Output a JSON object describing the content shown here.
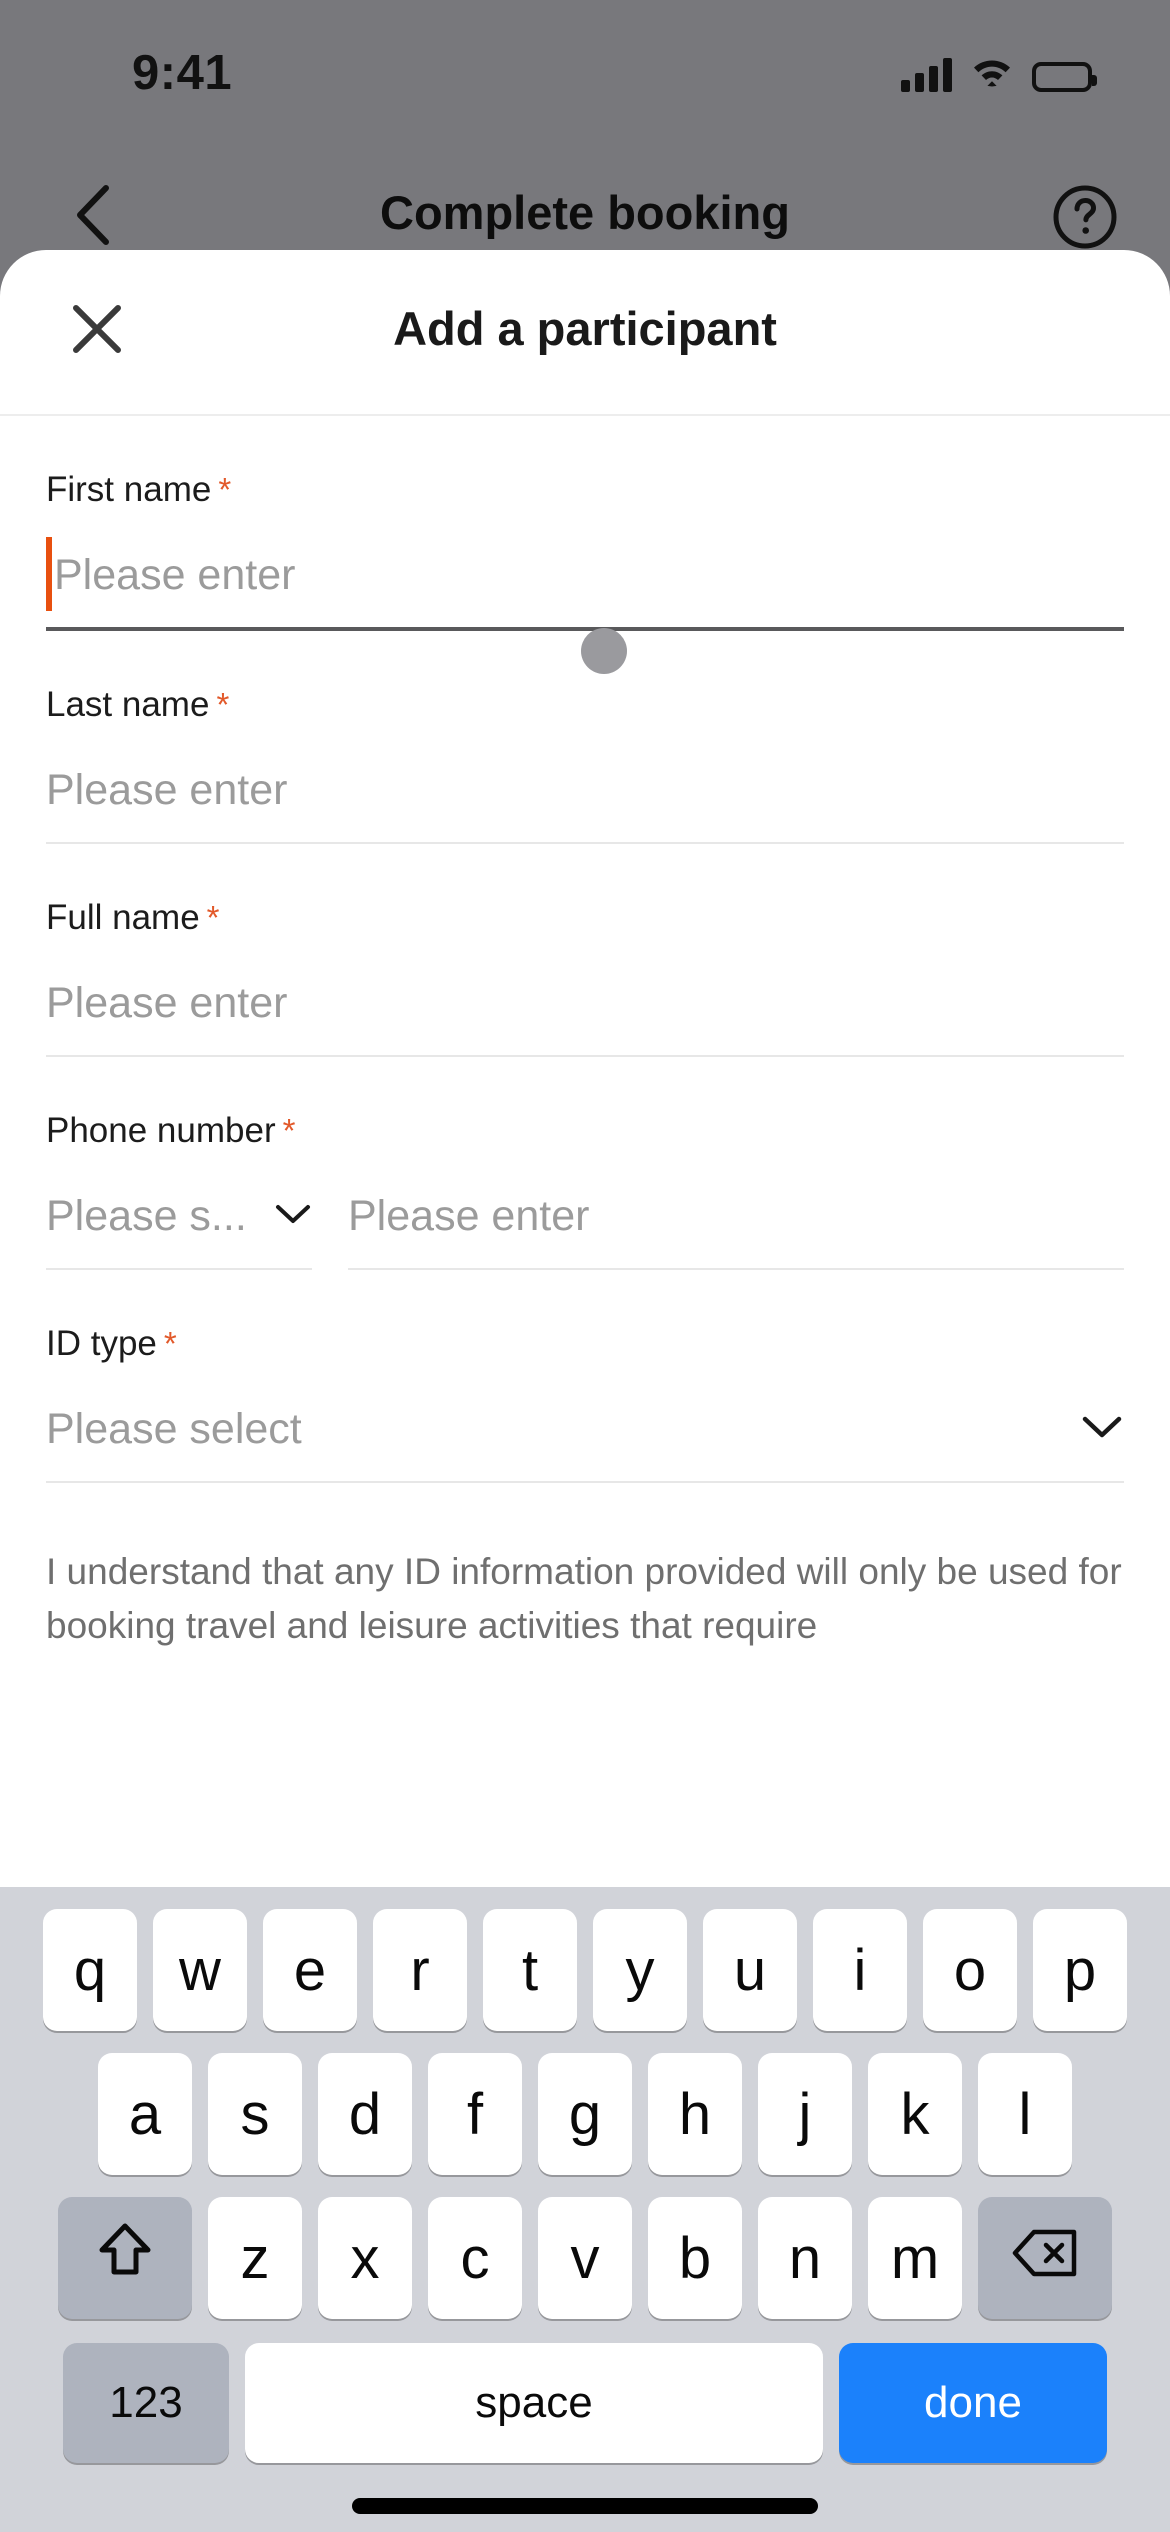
{
  "status_bar": {
    "time": "9:41",
    "signal_icon": "cellular-signal-icon",
    "wifi_icon": "wifi-icon",
    "battery_icon": "battery-full-icon"
  },
  "app_header": {
    "back_icon": "chevron-left-icon",
    "title": "Complete booking",
    "help_icon": "question-mark-circle-icon"
  },
  "sheet": {
    "close_icon": "close-x-icon",
    "title": "Add a participant"
  },
  "form": {
    "required_marker": "*",
    "fields": [
      {
        "label": "First name",
        "required": true,
        "placeholder": "Please enter",
        "value": "",
        "focused": true
      },
      {
        "label": "Last name",
        "required": true,
        "placeholder": "Please enter",
        "value": "",
        "focused": false
      },
      {
        "label": "Full name",
        "required": true,
        "placeholder": "Please enter",
        "value": "",
        "focused": false
      }
    ],
    "phone": {
      "label": "Phone number",
      "required": true,
      "country_code_placeholder": "Please s...",
      "country_code_value": "",
      "number_placeholder": "Please enter",
      "number_value": "",
      "chevron_icon": "chevron-down-icon"
    },
    "id_type": {
      "label": "ID type",
      "required": true,
      "placeholder": "Please select",
      "value": "",
      "chevron_icon": "chevron-down-icon"
    },
    "disclaimer": "I understand that any ID information provided will only be used for booking travel and leisure activities that require"
  },
  "touch_indicator": {
    "name": "tap-indicator",
    "color": "#9a9a9e"
  },
  "keyboard": {
    "row1": [
      "q",
      "w",
      "e",
      "r",
      "t",
      "y",
      "u",
      "i",
      "o",
      "p"
    ],
    "row2": [
      "a",
      "s",
      "d",
      "f",
      "g",
      "h",
      "j",
      "k",
      "l"
    ],
    "row3": [
      "z",
      "x",
      "c",
      "v",
      "b",
      "n",
      "m"
    ],
    "shift_icon": "shift-up-arrow-icon",
    "backspace_icon": "backspace-delete-icon",
    "numbers_key": "123",
    "space_key": "space",
    "done_key": "done",
    "home_indicator": "home-indicator-bar"
  },
  "colors": {
    "accent_orange": "#e8500f",
    "required_star": "#e2592a",
    "keyboard_bg": "#d1d3d9",
    "key_fn_bg": "#aeb3be",
    "done_blue": "#1b81fb",
    "backdrop_dim": "#78787c",
    "placeholder_grey": "#9b9b9b"
  }
}
